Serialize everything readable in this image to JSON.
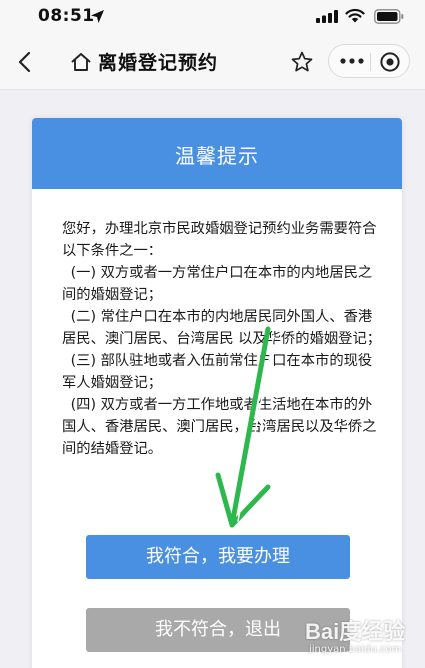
{
  "status_bar": {
    "time": "08:51"
  },
  "nav": {
    "title": "离婚登记预约"
  },
  "modal": {
    "title": "温馨提示",
    "intro": "您好，办理北京市民政婚姻登记预约业务需要符合以下条件之一：",
    "conditions": [
      "(一) 双方或者一方常住户口在本市的内地居民之间的婚姻登记；",
      "(二) 常住户口在本市的内地居民同外国人、香港居民、澳门居民、台湾居民 以及华侨的婚姻登记；",
      "(三) 部队驻地或者入伍前常住户口在本市的现役军人婚姻登记；",
      "(四) 双方或者一方工作地或者生活地在本市的外国人、香港居民、澳门居民，台湾居民以及华侨之间的结婚登记。"
    ],
    "agree_label": "我符合，我要办理",
    "exit_label": "我不符合，退出"
  },
  "watermark": {
    "logo": "Bai度经验",
    "sub": "jingyan.baidu.com"
  },
  "colors": {
    "accent": "#4a90e2",
    "disabled": "#a9a9a9",
    "annotation": "#2db84d"
  }
}
